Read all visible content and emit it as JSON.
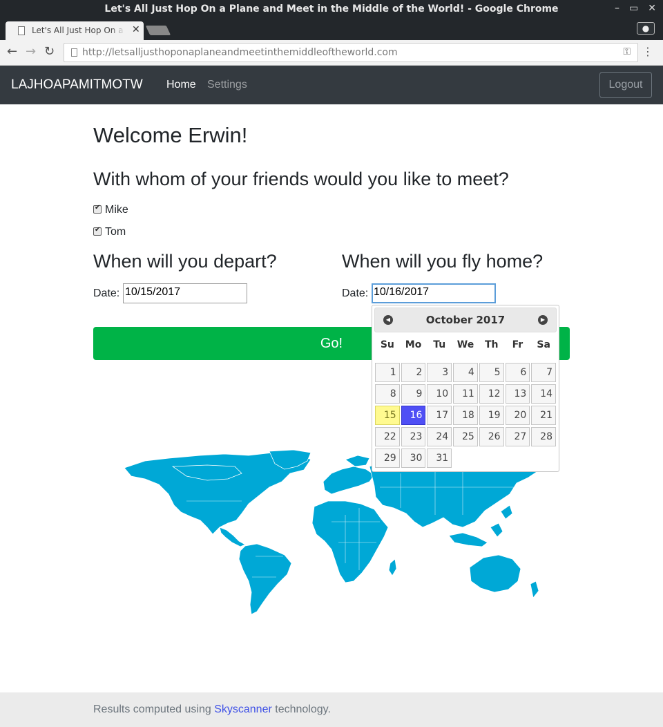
{
  "window": {
    "title": "Let's All Just Hop On a Plane and Meet in the Middle of the World! - Google Chrome",
    "tab_title": "Let's All Just Hop On a Plane and Meet in the Middle of the World!"
  },
  "toolbar": {
    "url": "http://letsalljusthoponaplaneandmeetinthemiddleoftheworld.com"
  },
  "navbar": {
    "brand": "LAJHOAPAMITMOTW",
    "links": [
      "Home",
      "Settings"
    ],
    "logout_label": "Logout"
  },
  "main": {
    "welcome": "Welcome Erwin!",
    "friends_question": "With whom of your friends would you like to meet?",
    "friends": [
      {
        "name": "Mike",
        "checked": true
      },
      {
        "name": "Tom",
        "checked": true
      }
    ],
    "depart_heading": "When will you depart?",
    "return_heading": "When will you fly home?",
    "date_label": "Date:",
    "depart_date": "10/15/2017",
    "return_date": "10/16/2017",
    "go_label": "Go!"
  },
  "datepicker": {
    "month_title": "October 2017",
    "days_of_week": [
      "Su",
      "Mo",
      "Tu",
      "We",
      "Th",
      "Fr",
      "Sa"
    ],
    "days": [
      "1",
      "2",
      "3",
      "4",
      "5",
      "6",
      "7",
      "8",
      "9",
      "10",
      "11",
      "12",
      "13",
      "14",
      "15",
      "16",
      "17",
      "18",
      "19",
      "20",
      "21",
      "22",
      "23",
      "24",
      "25",
      "26",
      "27",
      "28",
      "29",
      "30",
      "31"
    ],
    "today": "15",
    "selected": "16"
  },
  "footer": {
    "prefix": "Results computed using ",
    "link": "Skyscanner",
    "suffix": " technology."
  },
  "colors": {
    "navbar_bg": "#343a40",
    "go_button": "#00b347",
    "map": "#00a8d6",
    "today_highlight": "#fffa90",
    "selected_day": "#4f4ff5",
    "footer_link": "#3f51e6"
  }
}
